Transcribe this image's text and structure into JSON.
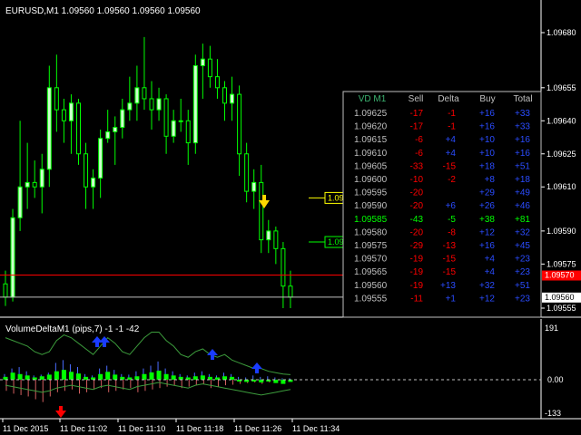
{
  "window": {
    "title": "EURUSD,M1  1.09560 1.09560 1.09560 1.09560"
  },
  "colors": {
    "background": "#000000",
    "candle_bull": "#ccffcc",
    "candle_bear": "#00ff00",
    "axis": "#ffffff",
    "ask_line": "#ff0000",
    "bid_line": "#c0c0c0",
    "sell_text": "#ff0000",
    "buy_text": "#2a4cff",
    "neutral_text": "#c0c0c0",
    "highlight_row": "#00ff00",
    "vd_title": "#3cb371",
    "up_arrow": "#1a3cff",
    "down_arrow": "#ff0000",
    "signal_arrow": "#ffd700"
  },
  "price_axis": {
    "ticks": [
      {
        "value": 1.0968,
        "label": "1.09680"
      },
      {
        "value": 1.09655,
        "label": "1.09655"
      },
      {
        "value": 1.0964,
        "label": "1.09640"
      },
      {
        "value": 1.09625,
        "label": "1.09625"
      },
      {
        "value": 1.0961,
        "label": "1.09610"
      },
      {
        "value": 1.0959,
        "label": "1.09590"
      },
      {
        "value": 1.09575,
        "label": "1.09575"
      },
      {
        "value": 1.09555,
        "label": "1.09555"
      }
    ],
    "ask_label": "1.09570",
    "ask_value": 1.0957,
    "bid_label": "1.09560",
    "bid_value": 1.0956
  },
  "price_labels": [
    {
      "label": "1.09605",
      "value": 1.09605,
      "color": "#ffff00"
    },
    {
      "label": "1.09585",
      "value": 1.09585,
      "color": "#00ff00"
    }
  ],
  "vd_table": {
    "headers": [
      "VD M1",
      "Sell",
      "Delta",
      "Buy",
      "Total"
    ],
    "rows": [
      {
        "price": "1.09625",
        "sell": "-17",
        "delta": "-1",
        "buy": "+16",
        "total": "+33"
      },
      {
        "price": "1.09620",
        "sell": "-17",
        "delta": "-1",
        "buy": "+16",
        "total": "+33"
      },
      {
        "price": "1.09615",
        "sell": "-6",
        "delta": "+4",
        "buy": "+10",
        "total": "+16"
      },
      {
        "price": "1.09610",
        "sell": "-6",
        "delta": "+4",
        "buy": "+10",
        "total": "+16"
      },
      {
        "price": "1.09605",
        "sell": "-33",
        "delta": "-15",
        "buy": "+18",
        "total": "+51"
      },
      {
        "price": "1.09600",
        "sell": "-10",
        "delta": "-2",
        "buy": "+8",
        "total": "+18"
      },
      {
        "price": "1.09595",
        "sell": "-20",
        "delta": "",
        "buy": "+29",
        "total": "+49"
      },
      {
        "price": "1.09590",
        "sell": "-20",
        "delta": "+6",
        "buy": "+26",
        "total": "+46"
      },
      {
        "price": "1.09585",
        "sell": "-43",
        "delta": "-5",
        "buy": "+38",
        "total": "+81",
        "highlight": true
      },
      {
        "price": "1.09580",
        "sell": "-20",
        "delta": "-8",
        "buy": "+12",
        "total": "+32"
      },
      {
        "price": "1.09575",
        "sell": "-29",
        "delta": "-13",
        "buy": "+16",
        "total": "+45"
      },
      {
        "price": "1.09570",
        "sell": "-19",
        "delta": "-15",
        "buy": "+4",
        "total": "+23"
      },
      {
        "price": "1.09565",
        "sell": "-19",
        "delta": "-15",
        "buy": "+4",
        "total": "+23"
      },
      {
        "price": "1.09560",
        "sell": "-19",
        "delta": "+13",
        "buy": "+32",
        "total": "+51"
      },
      {
        "price": "1.09555",
        "sell": "-11",
        "delta": "+1",
        "buy": "+12",
        "total": "+23"
      }
    ]
  },
  "indicator": {
    "title": "VolumeDeltaM1 (pips,7) -1 -1 -42",
    "axis_top": "191",
    "axis_zero": "0.00",
    "axis_bottom": "-133",
    "max": 191,
    "min": -133
  },
  "time_axis": {
    "labels": [
      "11 Dec 2015",
      "11 Dec 11:02",
      "11 Dec 11:10",
      "11 Dec 11:18",
      "11 Dec 11:26",
      "11 Dec 11:34"
    ]
  },
  "chart_data": {
    "type": "candlestick",
    "symbol": "EURUSD",
    "timeframe": "M1",
    "ylim": [
      1.0955,
      1.0969
    ],
    "candles": [
      {
        "o": 1.09566,
        "h": 1.09572,
        "l": 1.09556,
        "c": 1.0956
      },
      {
        "o": 1.0956,
        "h": 1.096,
        "l": 1.09558,
        "c": 1.09596
      },
      {
        "o": 1.09596,
        "h": 1.0964,
        "l": 1.0959,
        "c": 1.0961
      },
      {
        "o": 1.0961,
        "h": 1.0963,
        "l": 1.096,
        "c": 1.09612
      },
      {
        "o": 1.09612,
        "h": 1.09622,
        "l": 1.09605,
        "c": 1.0961
      },
      {
        "o": 1.0961,
        "h": 1.09625,
        "l": 1.09598,
        "c": 1.09618
      },
      {
        "o": 1.09618,
        "h": 1.09665,
        "l": 1.0961,
        "c": 1.09655
      },
      {
        "o": 1.09655,
        "h": 1.0967,
        "l": 1.09635,
        "c": 1.09645
      },
      {
        "o": 1.09645,
        "h": 1.0965,
        "l": 1.0963,
        "c": 1.0964
      },
      {
        "o": 1.0964,
        "h": 1.09652,
        "l": 1.09625,
        "c": 1.09648
      },
      {
        "o": 1.09648,
        "h": 1.0965,
        "l": 1.0962,
        "c": 1.09625
      },
      {
        "o": 1.09625,
        "h": 1.0963,
        "l": 1.096,
        "c": 1.0961
      },
      {
        "o": 1.0961,
        "h": 1.09618,
        "l": 1.096,
        "c": 1.09614
      },
      {
        "o": 1.09614,
        "h": 1.09636,
        "l": 1.09605,
        "c": 1.09632
      },
      {
        "o": 1.09632,
        "h": 1.09645,
        "l": 1.0963,
        "c": 1.09635
      },
      {
        "o": 1.09635,
        "h": 1.09642,
        "l": 1.0962,
        "c": 1.09637
      },
      {
        "o": 1.09637,
        "h": 1.0965,
        "l": 1.09632,
        "c": 1.09645
      },
      {
        "o": 1.09645,
        "h": 1.0966,
        "l": 1.0964,
        "c": 1.09648
      },
      {
        "o": 1.09648,
        "h": 1.09665,
        "l": 1.0964,
        "c": 1.09655
      },
      {
        "o": 1.09655,
        "h": 1.09678,
        "l": 1.09645,
        "c": 1.0965
      },
      {
        "o": 1.0965,
        "h": 1.09658,
        "l": 1.09636,
        "c": 1.09645
      },
      {
        "o": 1.09645,
        "h": 1.09655,
        "l": 1.0964,
        "c": 1.0965
      },
      {
        "o": 1.0965,
        "h": 1.09652,
        "l": 1.09625,
        "c": 1.09633
      },
      {
        "o": 1.09633,
        "h": 1.09645,
        "l": 1.0963,
        "c": 1.0964
      },
      {
        "o": 1.0964,
        "h": 1.0965,
        "l": 1.09635,
        "c": 1.0964
      },
      {
        "o": 1.0964,
        "h": 1.09645,
        "l": 1.0962,
        "c": 1.0963
      },
      {
        "o": 1.0963,
        "h": 1.0967,
        "l": 1.09625,
        "c": 1.09665
      },
      {
        "o": 1.09665,
        "h": 1.09675,
        "l": 1.0965,
        "c": 1.09668
      },
      {
        "o": 1.09668,
        "h": 1.09674,
        "l": 1.09655,
        "c": 1.0966
      },
      {
        "o": 1.0966,
        "h": 1.09668,
        "l": 1.0965,
        "c": 1.09655
      },
      {
        "o": 1.09655,
        "h": 1.09658,
        "l": 1.0964,
        "c": 1.09648
      },
      {
        "o": 1.09648,
        "h": 1.0966,
        "l": 1.0964,
        "c": 1.09652
      },
      {
        "o": 1.09652,
        "h": 1.09656,
        "l": 1.09615,
        "c": 1.09625
      },
      {
        "o": 1.09625,
        "h": 1.0963,
        "l": 1.09603,
        "c": 1.09608
      },
      {
        "o": 1.09608,
        "h": 1.09618,
        "l": 1.096,
        "c": 1.09612
      },
      {
        "o": 1.09612,
        "h": 1.0962,
        "l": 1.0958,
        "c": 1.09586
      },
      {
        "o": 1.09586,
        "h": 1.09595,
        "l": 1.0958,
        "c": 1.0959
      },
      {
        "o": 1.0959,
        "h": 1.09592,
        "l": 1.09575,
        "c": 1.09582
      },
      {
        "o": 1.09582,
        "h": 1.09585,
        "l": 1.09555,
        "c": 1.09565
      },
      {
        "o": 1.09565,
        "h": 1.09572,
        "l": 1.09555,
        "c": 1.0956
      }
    ],
    "volume_delta": {
      "positive": [
        20,
        40,
        45,
        30,
        15,
        18,
        25,
        60,
        70,
        55,
        45,
        20,
        15,
        40,
        50,
        35,
        20,
        18,
        30,
        40,
        50,
        65,
        40,
        30,
        20,
        15,
        25,
        30,
        20,
        15,
        25,
        20,
        10,
        8,
        15,
        10,
        12,
        8,
        5,
        5
      ],
      "negative": [
        -40,
        -50,
        -55,
        -60,
        -70,
        -80,
        -60,
        -45,
        -40,
        -35,
        -50,
        -45,
        -35,
        -30,
        -45,
        -40,
        -35,
        -30,
        -45,
        -40,
        -35,
        -30,
        -25,
        -20,
        -30,
        -25,
        -20,
        -15,
        -30,
        -25,
        -20,
        -18,
        -15,
        -12,
        -10,
        -15,
        -10,
        -8,
        -6,
        -5
      ],
      "delta": [
        10,
        25,
        20,
        15,
        8,
        12,
        18,
        30,
        35,
        28,
        22,
        10,
        8,
        20,
        28,
        18,
        10,
        8,
        12,
        20,
        26,
        32,
        20,
        15,
        10,
        8,
        12,
        15,
        10,
        8,
        12,
        10,
        -5,
        -8,
        -3,
        -10,
        -5,
        -12,
        -15,
        -8
      ],
      "line_top": [
        150,
        140,
        130,
        120,
        100,
        90,
        100,
        140,
        160,
        150,
        130,
        110,
        90,
        120,
        150,
        130,
        100,
        90,
        120,
        150,
        170,
        170,
        140,
        120,
        90,
        80,
        100,
        110,
        90,
        80,
        90,
        70,
        60,
        50,
        40,
        40,
        30,
        25,
        20,
        18
      ],
      "line_bottom": [
        -20,
        -25,
        -30,
        -35,
        -40,
        -45,
        -40,
        -30,
        -25,
        -20,
        -25,
        -30,
        -35,
        -25,
        -20,
        -25,
        -30,
        -35,
        -25,
        -20,
        -15,
        -10,
        -15,
        -20,
        -25,
        -30,
        -20,
        -15,
        -20,
        -25,
        -30,
        -35,
        -40,
        -45,
        -50,
        -55,
        -50,
        -45,
        -40,
        -35
      ]
    }
  }
}
